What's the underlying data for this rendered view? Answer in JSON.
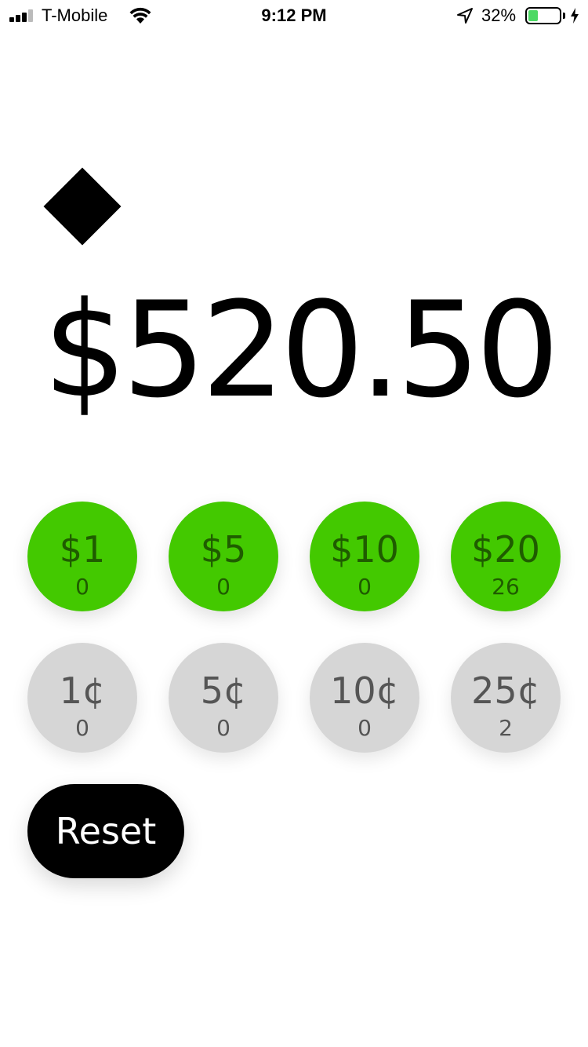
{
  "status_bar": {
    "carrier": "T-Mobile",
    "time": "9:12 PM",
    "battery_percent": "32%",
    "battery_level": 0.32,
    "icons": [
      "signal-icon",
      "wifi-icon",
      "location-arrow-icon",
      "battery-icon",
      "charging-bolt-icon"
    ]
  },
  "logo": {
    "icon": "diamond-icon"
  },
  "total": {
    "amount": "$520.50"
  },
  "bills": [
    {
      "label": "$1",
      "count": "0"
    },
    {
      "label": "$5",
      "count": "0"
    },
    {
      "label": "$10",
      "count": "0"
    },
    {
      "label": "$20",
      "count": "26"
    }
  ],
  "coins": [
    {
      "label": "1¢",
      "count": "0"
    },
    {
      "label": "5¢",
      "count": "0"
    },
    {
      "label": "10¢",
      "count": "0"
    },
    {
      "label": "25¢",
      "count": "2"
    }
  ],
  "reset_label": "Reset",
  "colors": {
    "bill_bg": "#43c900",
    "bill_text": "#1f5c00",
    "coin_bg": "#d6d6d6",
    "coin_text": "#555555",
    "reset_bg": "#000000",
    "battery_fill": "#4cd964"
  }
}
